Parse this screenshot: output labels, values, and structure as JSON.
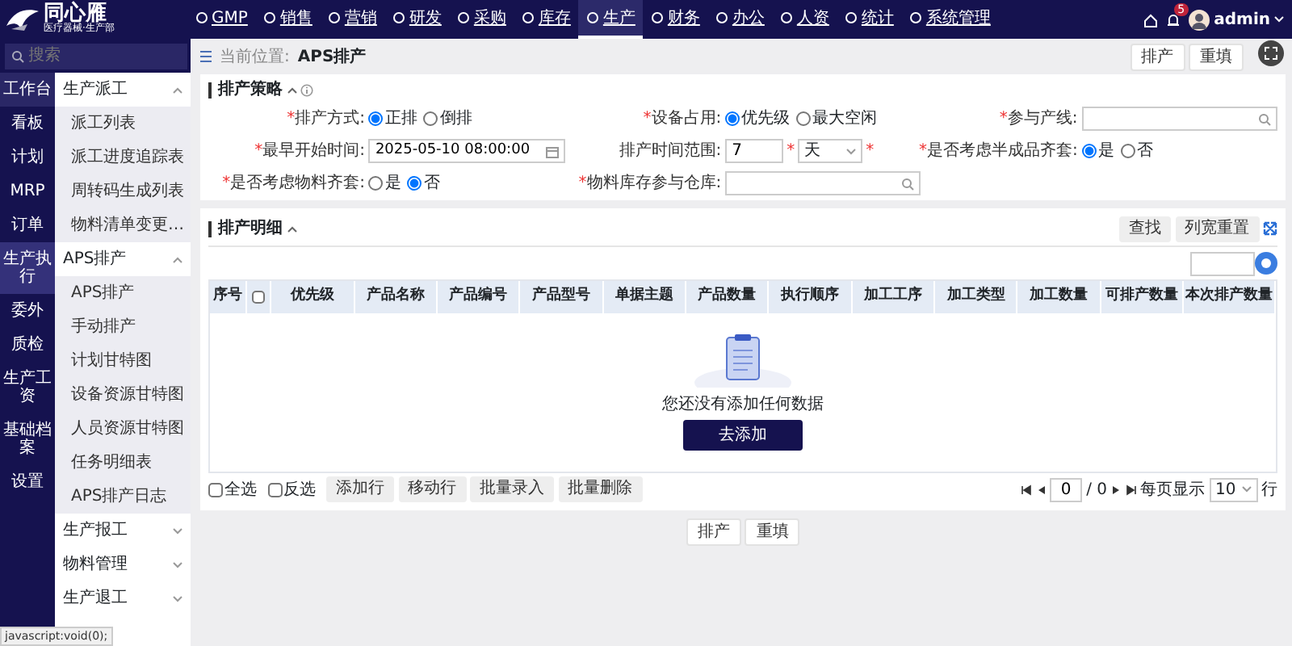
{
  "app": {
    "logo_title": "同心雁",
    "logo_subtitle": "医疗器械·生产部"
  },
  "top_nav": [
    {
      "label": "GMP",
      "selected": false
    },
    {
      "label": "销售",
      "selected": false
    },
    {
      "label": "营销",
      "selected": false
    },
    {
      "label": "研发",
      "selected": false
    },
    {
      "label": "采购",
      "selected": false
    },
    {
      "label": "库存",
      "selected": false
    },
    {
      "label": "生产",
      "selected": true
    },
    {
      "label": "财务",
      "selected": false
    },
    {
      "label": "办公",
      "selected": false
    },
    {
      "label": "人资",
      "selected": false
    },
    {
      "label": "统计",
      "selected": false
    },
    {
      "label": "系统管理",
      "selected": false
    }
  ],
  "user": {
    "name": "admin",
    "badge": "5"
  },
  "search": {
    "placeholder": "搜索"
  },
  "rail": [
    {
      "label": "工作台",
      "selected": false,
      "hovered": true
    },
    {
      "label": "看板",
      "selected": false,
      "hovered": false
    },
    {
      "label": "计划",
      "selected": false,
      "hovered": false
    },
    {
      "label": "MRP",
      "selected": false,
      "hovered": false
    },
    {
      "label": "订单",
      "selected": false,
      "hovered": false
    },
    {
      "label": "生产执行",
      "selected": true,
      "hovered": false
    },
    {
      "label": "委外",
      "selected": false,
      "hovered": false
    },
    {
      "label": "质检",
      "selected": false,
      "hovered": false
    },
    {
      "label": "生产工资",
      "selected": false,
      "hovered": false
    },
    {
      "label": "基础档案",
      "selected": false,
      "hovered": false
    },
    {
      "label": "设置",
      "selected": false,
      "hovered": false
    }
  ],
  "submenu": [
    {
      "label": "生产派工",
      "expanded": true,
      "children": [
        {
          "label": "派工列表"
        },
        {
          "label": "派工进度追踪表"
        },
        {
          "label": "周转码生成列表"
        },
        {
          "label": "物料清单变更…"
        }
      ]
    },
    {
      "label": "APS排产",
      "expanded": true,
      "children": [
        {
          "label": "APS排产"
        },
        {
          "label": "手动排产"
        },
        {
          "label": "计划甘特图"
        },
        {
          "label": "设备资源甘特图"
        },
        {
          "label": "人员资源甘特图"
        },
        {
          "label": "任务明细表"
        },
        {
          "label": "APS排产日志"
        }
      ]
    },
    {
      "label": "生产报工",
      "expanded": false
    },
    {
      "label": "物料管理",
      "expanded": false
    },
    {
      "label": "生产退工",
      "expanded": false
    }
  ],
  "breadcrumb": {
    "label": "当前位置:",
    "current": "APS排产"
  },
  "header_buttons": [
    "排产",
    "重填"
  ],
  "strategy": {
    "title": "排产策略",
    "required_mark": "*",
    "fields": [
      {
        "kind": "radio",
        "label": "排产方式:",
        "required": true,
        "options": [
          {
            "label": "正排",
            "selected": true
          },
          {
            "label": "倒排",
            "selected": false
          }
        ]
      },
      {
        "kind": "radio",
        "label": "设备占用:",
        "required": true,
        "options": [
          {
            "label": "优先级",
            "selected": true
          },
          {
            "label": "最大空闲",
            "selected": false
          }
        ]
      },
      {
        "kind": "search",
        "label": "参与产线:",
        "required": true
      },
      {
        "kind": "date",
        "label": "最早开始时间:",
        "required": true,
        "value": "2025-05-10 08:00:00"
      },
      {
        "kind": "range",
        "label": "排产时间范围:",
        "required": false,
        "value": "7",
        "value_required": true,
        "unit": "天",
        "unit_required": true
      },
      {
        "kind": "radio",
        "label": "是否考虑半成品齐套:",
        "required": true,
        "options": [
          {
            "label": "是",
            "selected": true
          },
          {
            "label": "否",
            "selected": false
          }
        ]
      },
      {
        "kind": "radio",
        "label": "是否考虑物料齐套:",
        "required": true,
        "options": [
          {
            "label": "是",
            "selected": false
          },
          {
            "label": "否",
            "selected": true
          }
        ]
      },
      {
        "kind": "search",
        "label": "物料库存参与仓库:",
        "required": true
      }
    ]
  },
  "details": {
    "title": "排产明细",
    "buttons": [
      "查找",
      "列宽重置"
    ],
    "header_checked": false,
    "columns": [
      "序号",
      "",
      "优先级",
      "产品名称",
      "产品编号",
      "产品型号",
      "单据主题",
      "产品数量",
      "执行顺序",
      "加工工序",
      "加工类型",
      "加工数量",
      "可排产数量",
      "本次排产数量"
    ],
    "empty_text": "您还没有添加任何数据",
    "add_button": "去添加",
    "footer": {
      "select_all": {
        "label": "全选",
        "checked": false
      },
      "invert": {
        "label": "反选",
        "checked": false
      },
      "buttons": [
        "添加行",
        "移动行",
        "批量录入",
        "批量删除"
      ],
      "page": "0",
      "total": "/ 0",
      "page_size_label": "每页显示",
      "page_size": "10",
      "rows_label": "行"
    }
  },
  "bottom_buttons": [
    "排产",
    "重填"
  ],
  "status_bar": "javascript:void(0);"
}
